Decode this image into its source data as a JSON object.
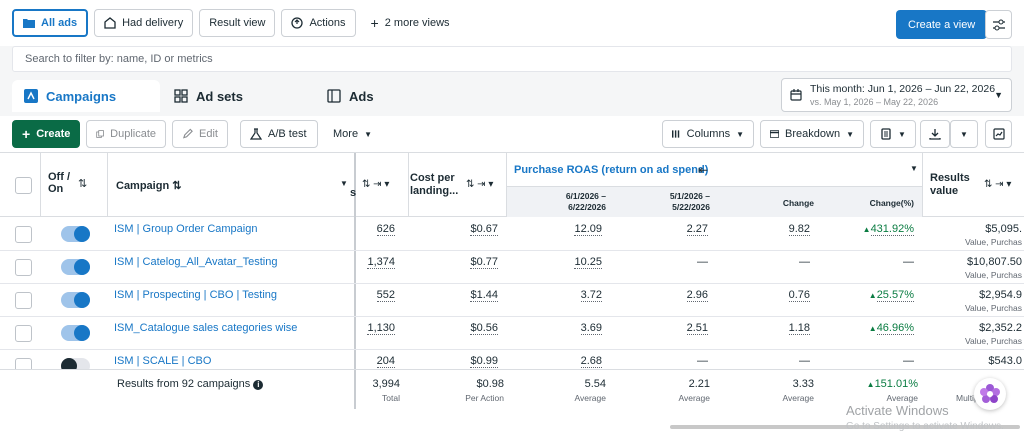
{
  "views": {
    "all_ads": "All ads",
    "had_delivery": "Had delivery",
    "result_view": "Result view",
    "actions": "Actions",
    "more_views": "2 more views",
    "create_view": "Create a view"
  },
  "search": {
    "placeholder": "Search to filter by: name, ID or metrics"
  },
  "tabs": [
    {
      "label": "Campaigns"
    },
    {
      "label": "Ad sets"
    },
    {
      "label": "Ads"
    }
  ],
  "date_range": {
    "current": "This month: Jun 1, 2026 – Jun 22, 2026",
    "compare": "vs. May 1, 2026 – May 22, 2026"
  },
  "toolbar": {
    "create": "Create",
    "duplicate": "Duplicate",
    "edit": "Edit",
    "ab_test": "A/B test",
    "more": "More",
    "columns": "Columns",
    "breakdown": "Breakdown"
  },
  "columns": {
    "off_on": "Off / On",
    "campaign": "Campaign",
    "results_partial": "s",
    "cost_per_landing": "Cost per landing...",
    "purchase_roas": "Purchase ROAS (return on ad spend)",
    "period_current": "6/1/2026 – 6/22/2026",
    "period_previous": "5/1/2026 – 5/22/2026",
    "change": "Change",
    "change_pct": "Change(%)",
    "results_value": "Results value"
  },
  "rows": [
    {
      "name": "ISM | Group Order Campaign",
      "on": true,
      "landing": "626",
      "cost": "$0.67",
      "roas_cur": "12.09",
      "roas_prev": "2.27",
      "change": "9.82",
      "change_pct": "431.92%",
      "value": "$5,095.",
      "value_sub": "Value, Purchas"
    },
    {
      "name": "ISM | Catelog_All_Avatar_Testing",
      "on": true,
      "landing": "1,374",
      "cost": "$0.77",
      "roas_cur": "10.25",
      "roas_prev": "—",
      "change": "—",
      "change_pct": "—",
      "value": "$10,807.50",
      "value_sub": "Value, Purchas"
    },
    {
      "name": "ISM | Prospecting | CBO | Testing",
      "on": true,
      "landing": "552",
      "cost": "$1.44",
      "roas_cur": "3.72",
      "roas_prev": "2.96",
      "change": "0.76",
      "change_pct": "25.57%",
      "value": "$2,954.9",
      "value_sub": "Value, Purchas"
    },
    {
      "name": "ISM_Catalogue sales categories wise",
      "on": true,
      "landing": "1,130",
      "cost": "$0.56",
      "roas_cur": "3.69",
      "roas_prev": "2.51",
      "change": "1.18",
      "change_pct": "46.96%",
      "value": "$2,352.2",
      "value_sub": "Value, Purchas"
    },
    {
      "name": "ISM | SCALE | CBO",
      "on": false,
      "landing": "204",
      "cost": "$0.99",
      "roas_cur": "2.68",
      "roas_prev": "—",
      "change": "—",
      "change_pct": "—",
      "value": "$543.0",
      "value_sub": ""
    }
  ],
  "totals": {
    "label": "Results from 92 campaigns",
    "landing": "3,994",
    "landing_sub": "Total",
    "cost": "$0.98",
    "cost_sub": "Per Action",
    "roas_cur": "5.54",
    "roas_cur_sub": "Average",
    "roas_prev": "2.21",
    "roas_prev_sub": "Average",
    "change": "3.33",
    "change_sub": "Average",
    "change_pct": "151.01%",
    "change_pct_sub": "Average",
    "value_sub": "Multip"
  },
  "watermark": {
    "title": "Activate Windows",
    "subtitle": "Go to Settings to activate Windows."
  },
  "colors": {
    "accent": "#1877c6",
    "create": "#0a6b46",
    "positive": "#0a7c42"
  }
}
